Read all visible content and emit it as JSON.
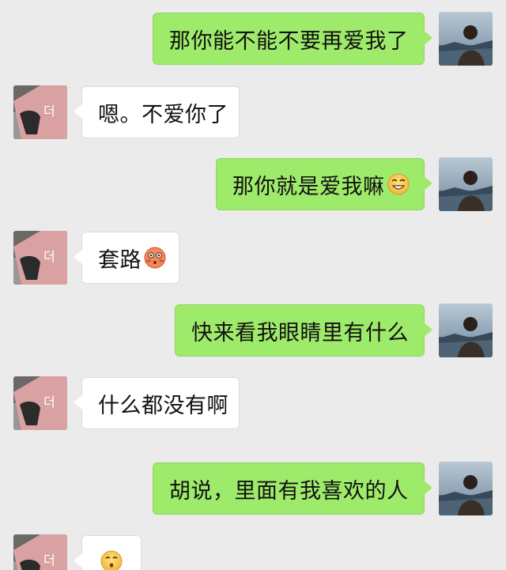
{
  "messages": [
    {
      "side": "out",
      "text": "那你能不能不要再爱我了"
    },
    {
      "side": "in",
      "text": "嗯。不爱你了"
    },
    {
      "side": "out",
      "text": "那你就是爱我嘛",
      "emoji": "smirk-grin-emoji"
    },
    {
      "side": "in",
      "text": "套路",
      "emoji": "flushed-blush-emoji"
    },
    {
      "side": "out",
      "text": "快来看我眼睛里有什么"
    },
    {
      "side": "in",
      "text": "什么都没有啊"
    },
    {
      "side": "out",
      "text": "胡说，里面有我喜欢的人"
    },
    {
      "side": "in",
      "text": "",
      "emoji": "kissing-emoji"
    }
  ],
  "avatars": {
    "self": "man-by-lake-avatar",
    "other": "hand-photo-avatar"
  },
  "colors": {
    "outgoing_bubble": "#9eea6a",
    "incoming_bubble": "#ffffff",
    "background": "#ebebeb"
  }
}
